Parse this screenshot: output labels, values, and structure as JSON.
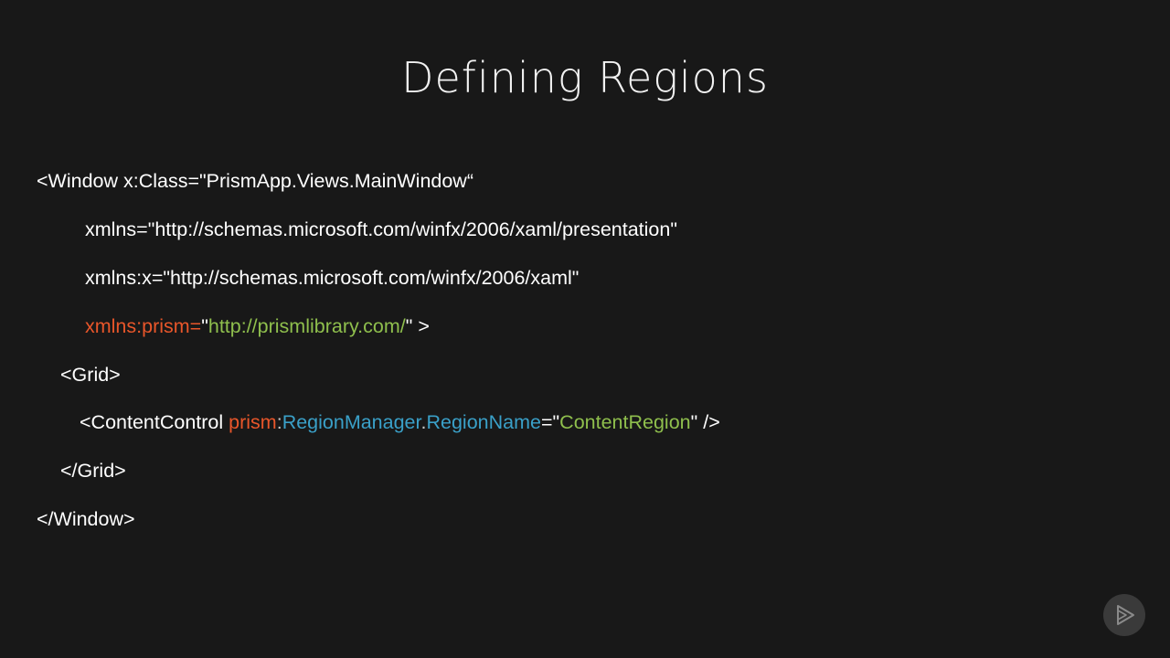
{
  "slide": {
    "title": "Defining Regions"
  },
  "code": {
    "line1": "<Window x:Class=\"PrismApp.Views.MainWindow“",
    "line2": "xmlns=\"http://schemas.microsoft.com/winfx/2006/xaml/presentation\"",
    "line3": "xmlns:x=\"http://schemas.microsoft.com/winfx/2006/xaml\"",
    "line4": {
      "attr": "xmlns:prism=",
      "quote_open": "\"",
      "url": "http://prismlibrary.com/",
      "rest": "\" >"
    },
    "line5": "<Grid>",
    "line6": {
      "tag": "<ContentControl ",
      "prefix": "prism",
      "colon": ":",
      "manager": "RegionManager",
      "dot": ".",
      "property": "RegionName",
      "eq": "=\"",
      "value": "ContentRegion",
      "end": "\" />"
    },
    "line7": "</Grid>",
    "line8": "</Window>"
  },
  "colors": {
    "background": "#181818",
    "text": "#ffffff",
    "namespace_attr": "#e8562a",
    "string_value": "#8fbf4d",
    "identifier": "#3aa0c8"
  },
  "logo": {
    "icon": "play-icon"
  }
}
